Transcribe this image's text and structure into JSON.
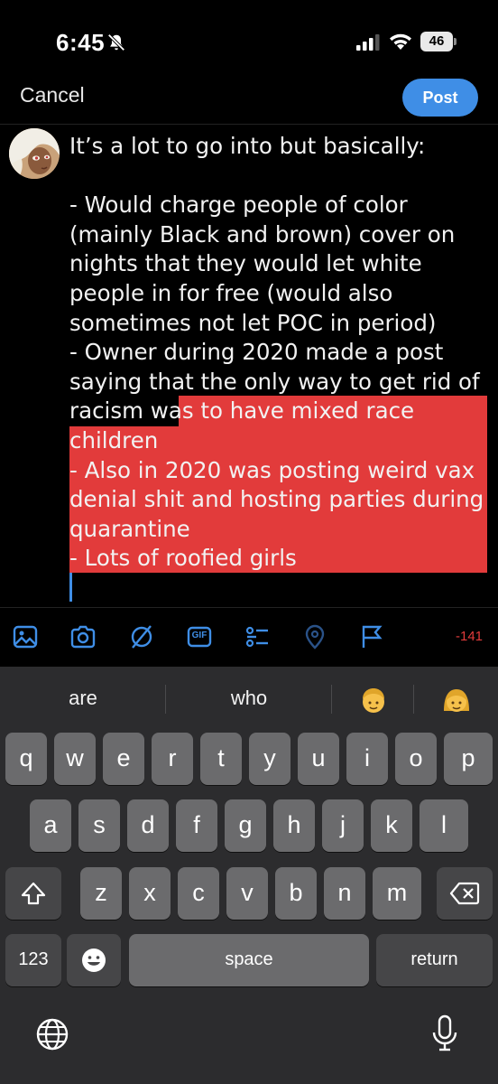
{
  "status_bar": {
    "time": "6:45",
    "battery": "46"
  },
  "compose": {
    "cancel_label": "Cancel",
    "post_label": "Post",
    "text": "It’s a lot to go into but basically:\n\n- Would charge people of color (mainly Black and brown) cover on nights that they would let white people in for free (would also sometimes not let POC in period)\n- Owner during 2020 made a post saying that the only way to get rid of racism was to have mixed race children\n- Also in 2020 was posting weird vax denial shit and hosting parties during quarantine\n- Lots of roofied girls",
    "char_count": "-141",
    "accent_color": "#3f8ee6",
    "selection_color": "#e23b3b"
  },
  "toolbar": {
    "icons": [
      "image-icon",
      "camera-icon",
      "no-filter-icon",
      "gif-icon",
      "poll-icon",
      "location-icon",
      "flag-icon"
    ],
    "gif_label": "GIF"
  },
  "keyboard": {
    "suggestions": [
      "are",
      "who"
    ],
    "emoji_suggestions": [
      "boy-emoji",
      "girl-emoji"
    ],
    "row1": [
      "q",
      "w",
      "e",
      "r",
      "t",
      "y",
      "u",
      "i",
      "o",
      "p"
    ],
    "row2": [
      "a",
      "s",
      "d",
      "f",
      "g",
      "h",
      "j",
      "k",
      "l"
    ],
    "row3": [
      "z",
      "x",
      "c",
      "v",
      "b",
      "n",
      "m"
    ],
    "numbers_label": "123",
    "space_label": "space",
    "return_label": "return"
  }
}
